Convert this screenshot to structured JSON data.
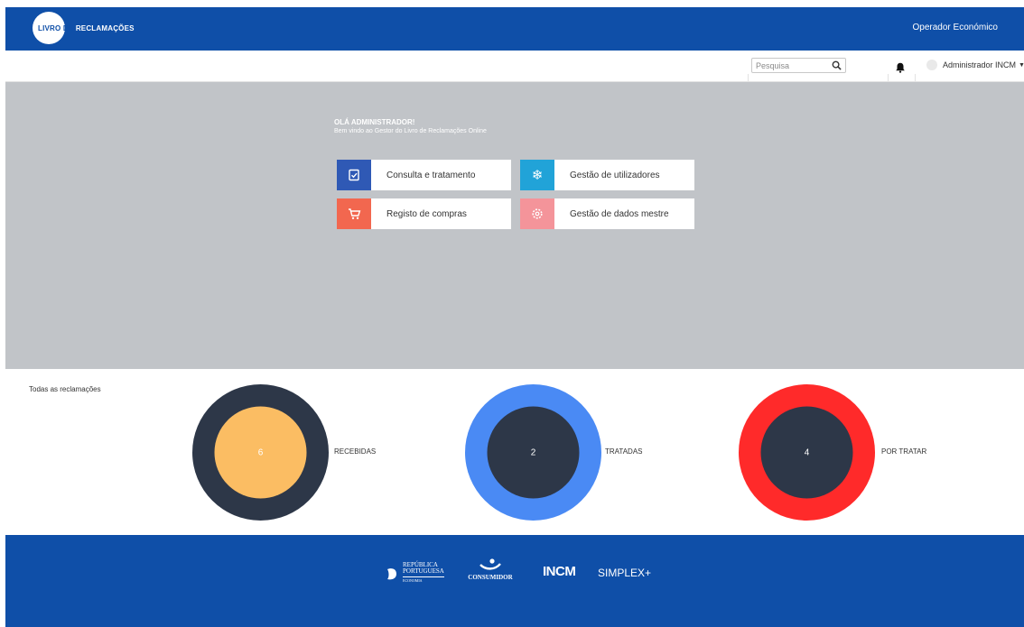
{
  "header": {
    "logo_part1": "LIVRO DE ",
    "logo_part2": "RECLAMAÇÕES",
    "operador": "Operador Económico"
  },
  "subbar": {
    "search_placeholder": "Pesquisa",
    "user_name": "Administrador INCM"
  },
  "hero": {
    "greeting": "OLÁ ADMINISTRADOR!",
    "welcome": "Bem vindo ao Gestor do Livro de Reclamações Online",
    "tiles": [
      {
        "label": "Consulta e tratamento",
        "icon": "file-check-icon",
        "color": "#2f59b5"
      },
      {
        "label": "Gestão de utilizadores",
        "icon": "snowflake-icon",
        "color": "#21a3d8"
      },
      {
        "label": "Registo de compras",
        "icon": "shopping-cart-icon",
        "color": "#f2674f"
      },
      {
        "label": "Gestão de dados mestre",
        "icon": "gear-icon",
        "color": "#f4949a"
      }
    ]
  },
  "stats": {
    "title": "Todas as reclamações",
    "items": [
      {
        "value": "6",
        "label": "RECEBIDAS",
        "outer_color": "#2d3748",
        "inner_color": "#fbbd63"
      },
      {
        "value": "2",
        "label": "TRATADAS",
        "outer_color": "#4a8af4",
        "inner_color": "#2d3748"
      },
      {
        "value": "4",
        "label": "POR TRATAR",
        "outer_color": "#ff2a2a",
        "inner_color": "#2d3748"
      }
    ]
  },
  "footer": {
    "republica_line1": "REPÚBLICA",
    "republica_line2": "PORTUGUESA",
    "republica_line3": "ECONOMIA",
    "consumidor": "CONSUMIDOR",
    "incm": "INCM",
    "simplex": "SIMPLEX+"
  },
  "colors": {
    "primary": "#0f4fa8",
    "hero_bg": "#c1c4c8"
  }
}
